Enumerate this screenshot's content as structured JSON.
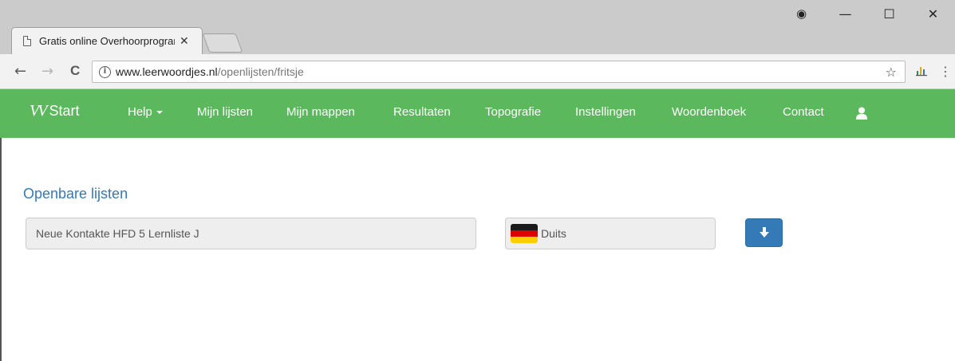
{
  "browser": {
    "tab_title": "Gratis online Overhoorprogramma",
    "tab_close": "✕",
    "controls": {
      "profile": "◉",
      "minimize": "—",
      "maximize": "☐",
      "close": "✕"
    },
    "nav": {
      "back": "←",
      "forward": "→",
      "reload": "C"
    },
    "address": {
      "info": "i",
      "domain": "www.leerwoordjes.nl",
      "path": "/openlijsten/fritsje"
    },
    "bookmark_star": "☆",
    "menu": "⋮"
  },
  "navbar": {
    "brand_logo": "VV",
    "brand_label": "Start",
    "items": [
      {
        "label": "Help"
      },
      {
        "label": "Mijn lijsten"
      },
      {
        "label": "Mijn mappen"
      },
      {
        "label": "Resultaten"
      },
      {
        "label": "Topografie"
      },
      {
        "label": "Instellingen"
      },
      {
        "label": "Woordenboek"
      },
      {
        "label": "Contact"
      }
    ],
    "accent_color": "#5cb85c"
  },
  "content": {
    "heading": "Openbare lijsten",
    "list_name": "Neue Kontakte HFD 5 Lernliste J",
    "language": "Duits",
    "flag_colors": [
      "#1a1a1a",
      "#dd0000",
      "#ffce00"
    ],
    "button_color": "#337ab7"
  }
}
